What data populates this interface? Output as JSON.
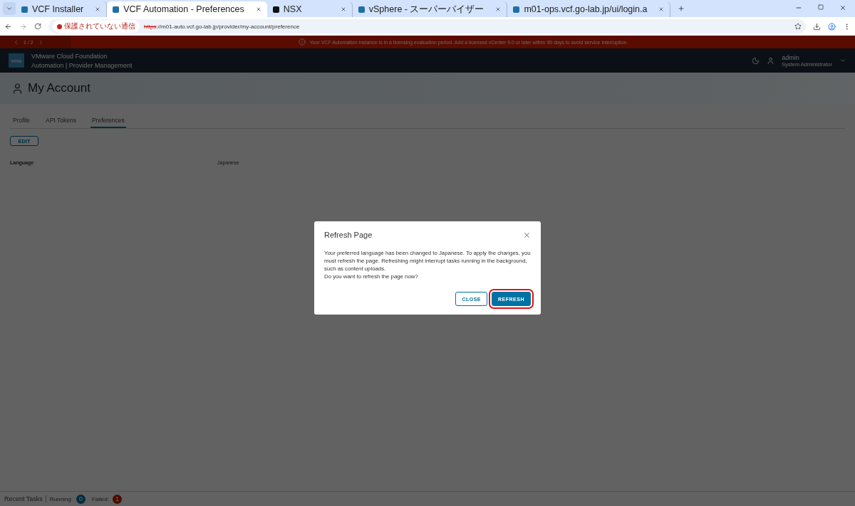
{
  "browser": {
    "tabs": [
      {
        "title": "VCF Installer",
        "selected": false,
        "color": "#1d6fa5"
      },
      {
        "title": "VCF Automation - Preferences",
        "selected": true,
        "color": "#1d6fa5"
      },
      {
        "title": "NSX",
        "selected": false,
        "color": "#111111"
      },
      {
        "title": "vSphere - スーパーバイザー",
        "selected": false,
        "color": "#1d6fa5"
      },
      {
        "title": "m01-ops.vcf.go-lab.jp/ui/login.a",
        "selected": false,
        "color": "#1d6fa5"
      }
    ],
    "security_label": "保護されていない通信",
    "url_scheme": "https",
    "url_rest": "://m01-auto.vcf.go-lab.jp/provider/my-account/preference"
  },
  "banner": {
    "pager": "1 / 2",
    "message": "Your VCF Automation instance is in a licensing evaluation period. Add a licensed vCenter 9.0 or later within 90 days to avoid service interruption."
  },
  "header": {
    "logo": "vmw",
    "title": "VMware Cloud Foundation",
    "subtitle": "Automation | Provider Management",
    "user": "admin",
    "role": "System Administrator"
  },
  "page": {
    "title": "My Account",
    "tabs": [
      {
        "label": "Profile",
        "selected": false
      },
      {
        "label": "API Tokens",
        "selected": false
      },
      {
        "label": "Preferences",
        "selected": true
      }
    ],
    "edit_button": "EDIT",
    "fields": [
      {
        "label": "Language",
        "value": "Japanese"
      }
    ]
  },
  "dialog": {
    "title": "Refresh Page",
    "message": "Your preferred language has been changed to Japanese. To apply the changes, you must refresh the page. Refreshing might interrupt tasks running in the background, such as content uploads.",
    "question": "Do you want to refresh the page now?",
    "buttons": [
      {
        "label": "CLOSE",
        "kind": "secondary",
        "highlighted": false
      },
      {
        "label": "REFRESH",
        "kind": "primary",
        "highlighted": true
      }
    ]
  },
  "footer": {
    "title": "Recent Tasks",
    "running_label": "Running:",
    "running_count": "0",
    "failed_label": "Failed:",
    "failed_count": "1"
  }
}
